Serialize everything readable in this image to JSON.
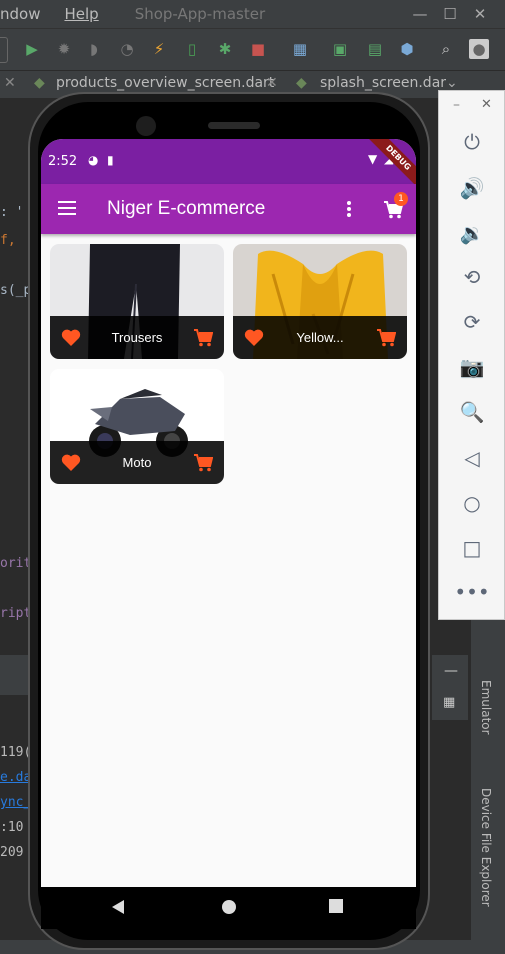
{
  "ide": {
    "menu": [
      "ndow",
      "Help"
    ],
    "window_title": "Shop-App-master",
    "tabs": [
      "products_overview_screen.dart",
      "splash_screen.dar"
    ],
    "tool_windows": [
      "Emulator",
      "Device File Explorer"
    ],
    "code_fragments": [
      ": '",
      "f,",
      "s(_p",
      "orit",
      "ript",
      "119(",
      "e.da",
      "ync_",
      ":10",
      "209"
    ]
  },
  "emulator_panel": {
    "buttons": [
      "power-icon",
      "volume-up-icon",
      "volume-down-icon",
      "rotate-left-icon",
      "rotate-right-icon",
      "camera-icon",
      "zoom-icon",
      "back-icon",
      "home-icon",
      "overview-icon",
      "more-icon"
    ]
  },
  "phone": {
    "status_time": "2:52",
    "debug_label": "DEBUG",
    "app_title": "Niger E-commerce",
    "cart_badge": "1",
    "products": [
      {
        "title": "Trousers",
        "favorite": true
      },
      {
        "title": "Yellow...",
        "favorite": true
      },
      {
        "title": "Moto",
        "favorite": true
      }
    ]
  },
  "colors": {
    "status_bar": "#7b1fa2",
    "app_bar": "#9c27b0",
    "accent": "#ff5722",
    "ide_bg": "#2b2b2b"
  }
}
